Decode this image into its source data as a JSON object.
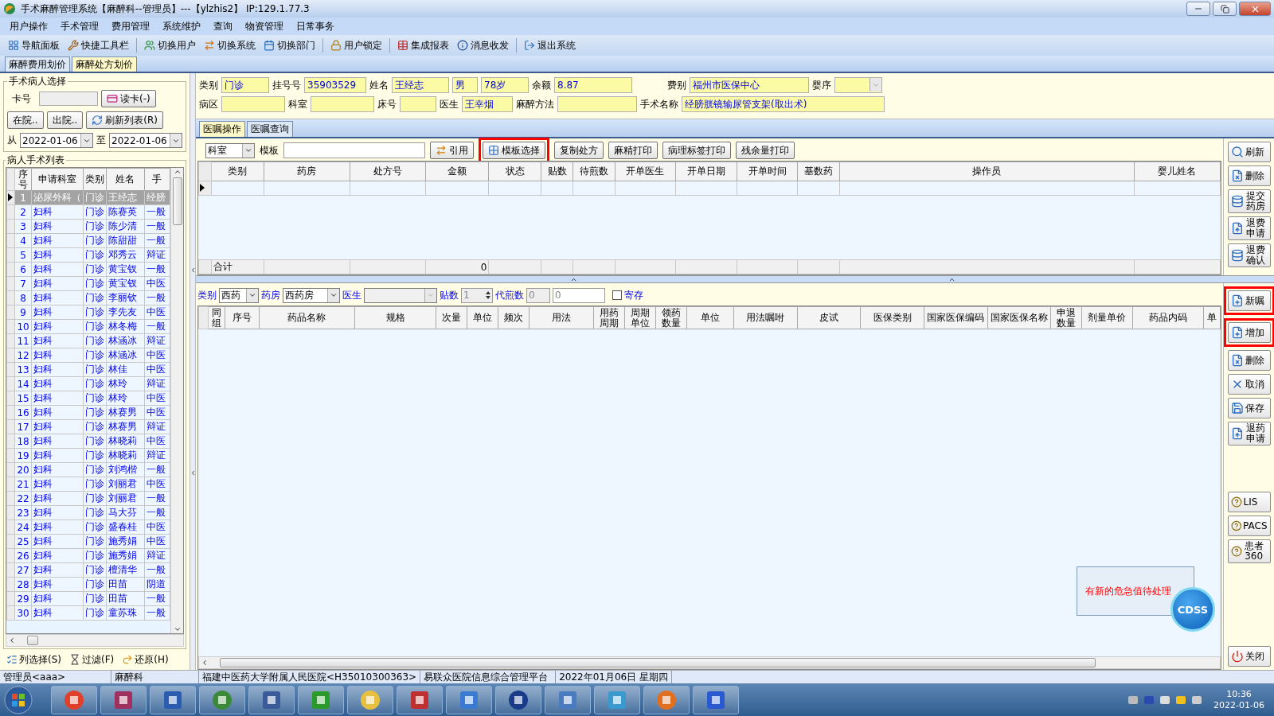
{
  "window": {
    "title": "手术麻醉管理系统【麻醉科--管理员】---【ylzhis2】 IP:129.1.77.3"
  },
  "menu": [
    "用户操作",
    "手术管理",
    "费用管理",
    "系统维护",
    "查询",
    "物资管理",
    "日常事务"
  ],
  "toolbar": [
    "导航面板",
    "快捷工具栏",
    "切换用户",
    "切换系统",
    "切换部门",
    "用户锁定",
    "集成报表",
    "消息收发",
    "退出系统"
  ],
  "main_tabs": [
    {
      "label": "麻醉费用划价",
      "selected": false
    },
    {
      "label": "麻醉处方划价",
      "selected": true
    }
  ],
  "patient_select": {
    "title": "手术病人选择",
    "card_label": "卡号",
    "read_card_button": "读卡(-)",
    "in_hospital_button": "在院..",
    "discharged_button": "出院..",
    "refresh_button": "刷新列表(R)",
    "from_label": "从",
    "from_date": "2022-01-06",
    "to_label": "至",
    "to_date": "2022-01-06"
  },
  "patient_list": {
    "title": "病人手术列表",
    "columns": [
      "序号",
      "申请科室",
      "类别",
      "姓名",
      "手"
    ],
    "rows": [
      {
        "cells": [
          "1",
          "泌尿外科（",
          "门诊",
          "王经志",
          "经膀"
        ],
        "selected": true
      },
      {
        "cells": [
          "2",
          "妇科",
          "门诊",
          "陈赛英",
          "一般"
        ],
        "selected": false
      },
      {
        "cells": [
          "3",
          "妇科",
          "门诊",
          "陈少清",
          "一般"
        ],
        "selected": false
      },
      {
        "cells": [
          "4",
          "妇科",
          "门诊",
          "陈甜甜",
          "一般"
        ],
        "selected": false
      },
      {
        "cells": [
          "5",
          "妇科",
          "门诊",
          "邓秀云",
          "辩证"
        ],
        "selected": false
      },
      {
        "cells": [
          "6",
          "妇科",
          "门诊",
          "黄宝钗",
          "一般"
        ],
        "selected": false
      },
      {
        "cells": [
          "7",
          "妇科",
          "门诊",
          "黄宝钗",
          "中医"
        ],
        "selected": false
      },
      {
        "cells": [
          "8",
          "妇科",
          "门诊",
          "李丽钦",
          "一般"
        ],
        "selected": false
      },
      {
        "cells": [
          "9",
          "妇科",
          "门诊",
          "李先友",
          "中医"
        ],
        "selected": false
      },
      {
        "cells": [
          "10",
          "妇科",
          "门诊",
          "林冬梅",
          "一般"
        ],
        "selected": false
      },
      {
        "cells": [
          "11",
          "妇科",
          "门诊",
          "林涵冰",
          "辩证"
        ],
        "selected": false
      },
      {
        "cells": [
          "12",
          "妇科",
          "门诊",
          "林涵冰",
          "中医"
        ],
        "selected": false
      },
      {
        "cells": [
          "13",
          "妇科",
          "门诊",
          "林佳",
          "中医"
        ],
        "selected": false
      },
      {
        "cells": [
          "14",
          "妇科",
          "门诊",
          "林玲",
          "辩证"
        ],
        "selected": false
      },
      {
        "cells": [
          "15",
          "妇科",
          "门诊",
          "林玲",
          "中医"
        ],
        "selected": false
      },
      {
        "cells": [
          "16",
          "妇科",
          "门诊",
          "林赛男",
          "中医"
        ],
        "selected": false
      },
      {
        "cells": [
          "17",
          "妇科",
          "门诊",
          "林赛男",
          "辩证"
        ],
        "selected": false
      },
      {
        "cells": [
          "18",
          "妇科",
          "门诊",
          "林晓莉",
          "中医"
        ],
        "selected": false
      },
      {
        "cells": [
          "19",
          "妇科",
          "门诊",
          "林晓莉",
          "辩证"
        ],
        "selected": false
      },
      {
        "cells": [
          "20",
          "妇科",
          "门诊",
          "刘鸿楷",
          "一般"
        ],
        "selected": false
      },
      {
        "cells": [
          "21",
          "妇科",
          "门诊",
          "刘丽君",
          "中医"
        ],
        "selected": false
      },
      {
        "cells": [
          "22",
          "妇科",
          "门诊",
          "刘丽君",
          "一般"
        ],
        "selected": false
      },
      {
        "cells": [
          "23",
          "妇科",
          "门诊",
          "马大芬",
          "一般"
        ],
        "selected": false
      },
      {
        "cells": [
          "24",
          "妇科",
          "门诊",
          "盛春桂",
          "中医"
        ],
        "selected": false
      },
      {
        "cells": [
          "25",
          "妇科",
          "门诊",
          "施秀娟",
          "中医"
        ],
        "selected": false
      },
      {
        "cells": [
          "26",
          "妇科",
          "门诊",
          "施秀娟",
          "辩证"
        ],
        "selected": false
      },
      {
        "cells": [
          "27",
          "妇科",
          "门诊",
          "檀清华",
          "一般"
        ],
        "selected": false
      },
      {
        "cells": [
          "28",
          "妇科",
          "门诊",
          "田苗",
          "阴道"
        ],
        "selected": false
      },
      {
        "cells": [
          "29",
          "妇科",
          "门诊",
          "田苗",
          "一般"
        ],
        "selected": false
      },
      {
        "cells": [
          "30",
          "妇科",
          "门诊",
          "童苏珠",
          "一般"
        ],
        "selected": false
      }
    ]
  },
  "list_footer": [
    "列选择(S)",
    "过滤(F)",
    "还原(H)"
  ],
  "patient_info": {
    "category": {
      "label": "类别",
      "value": "门诊"
    },
    "registration_no": {
      "label": "挂号号",
      "value": "35903529"
    },
    "name": {
      "label": "姓名",
      "value": "王经志"
    },
    "sex": {
      "value": "男"
    },
    "age": {
      "value": "78岁"
    },
    "balance": {
      "label": "余额",
      "value": "8.87"
    },
    "fee_type": {
      "label": "费别",
      "value": "福州市医保中心"
    },
    "infant_order": {
      "label": "婴序",
      "kind": "select"
    },
    "ward": {
      "label": "病区"
    },
    "department": {
      "label": "科室"
    },
    "bed": {
      "label": "床号"
    },
    "doctor": {
      "label": "医生",
      "value": "王幸烟"
    },
    "anesthesia_method": {
      "label": "麻醉方法"
    },
    "surgery_name": {
      "label": "手术名称",
      "value": "经膀胱镜输尿管支架(取出术)"
    }
  },
  "order_tabs": [
    {
      "label": "医嘱操作",
      "selected": true
    },
    {
      "label": "医嘱查询",
      "selected": false
    }
  ],
  "order_toolbar": {
    "scope": "科室",
    "template_label": "模板",
    "buttons": [
      {
        "label": "引用",
        "highlighted": false
      },
      {
        "label": "模板选择",
        "highlighted": true
      },
      {
        "label": "复制处方",
        "highlighted": false
      },
      {
        "label": "麻精打印",
        "highlighted": false
      },
      {
        "label": "病理标签打印",
        "highlighted": false
      },
      {
        "label": "残余量打印",
        "highlighted": false
      }
    ]
  },
  "prescription_grid": {
    "columns": [
      "类别",
      "药房",
      "处方号",
      "金额",
      "状态",
      "贴数",
      "待煎数",
      "开单医生",
      "开单日期",
      "开单时间",
      "基数药",
      "操作员",
      "婴儿姓名"
    ],
    "total_label": "合计",
    "total_amount": "0"
  },
  "upper_side_buttons": [
    {
      "label": "刷新",
      "highlighted": false
    },
    {
      "label": "删除",
      "highlighted": false
    },
    {
      "label": "提交药房",
      "highlighted": false
    },
    {
      "label": "退费申请",
      "highlighted": false
    },
    {
      "label": "退费确认",
      "highlighted": false
    }
  ],
  "drug_filter": {
    "type_label": "类别",
    "type_value": "西药",
    "pharmacy_label": "药房",
    "pharmacy_value": "西药房",
    "doctor_label": "医生",
    "doctor_disabled": true,
    "doses_label": "贴数",
    "doses_value": "1",
    "decoct_label": "代煎数",
    "decoct_value": "0",
    "decoct_extra": "0",
    "deposit_label": "寄存",
    "deposit_checked": false
  },
  "drug_grid": {
    "columns": [
      "同组",
      "序号",
      "药品名称",
      "规格",
      "次量",
      "单位",
      "频次",
      "用法",
      "用药周期",
      "周期单位",
      "领药数量",
      "单位",
      "用法嘱咐",
      "皮试",
      "医保类别",
      "国家医保编码",
      "国家医保名称",
      "申退数量",
      "剂量单价",
      "药品内码",
      "单"
    ]
  },
  "lower_side_buttons": [
    {
      "label": "新嘱",
      "highlighted": true
    },
    {
      "label": "增加",
      "highlighted": true
    },
    {
      "label": "删除",
      "highlighted": false
    },
    {
      "label": "取消",
      "highlighted": false
    },
    {
      "label": "保存",
      "highlighted": false
    },
    {
      "label": "退药申请",
      "highlighted": false
    }
  ],
  "info_buttons": [
    "LIS",
    "PACS",
    "患者360"
  ],
  "close_button": "关闭",
  "alert": {
    "text": "有新的危急值待处理",
    "badge": "CDSS"
  },
  "status_bar": [
    "管理员<aaa>",
    "麻醉科",
    "福建中医药大学附属人民医院<H35010300363>",
    "易联众医院信息综合管理平台",
    "2022年01月06日 星期四"
  ],
  "taskbar": {
    "time": "10:36",
    "date": "2022-01-06"
  }
}
